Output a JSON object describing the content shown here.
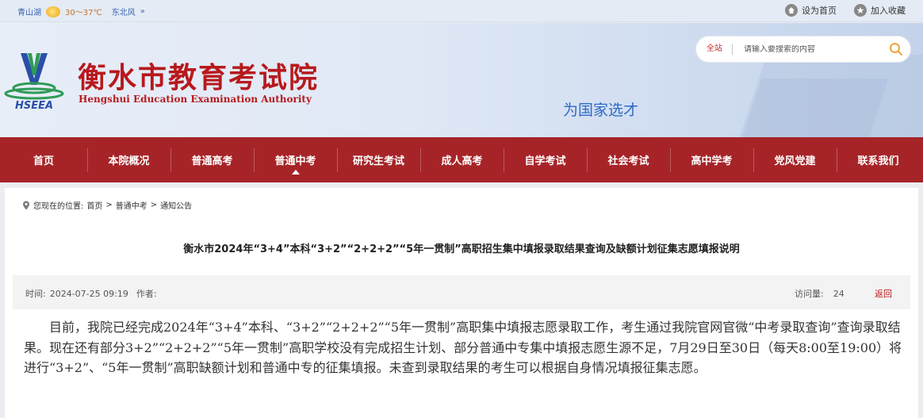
{
  "topbar": {
    "weather": {
      "city": "青山湖",
      "temp": "30～37℃",
      "wind": "东北风",
      "more": "»"
    },
    "links": [
      {
        "label": "设为首页",
        "icon": "home-icon"
      },
      {
        "label": "加入收藏",
        "icon": "star-icon"
      }
    ]
  },
  "header": {
    "logo_text": "HSEEA",
    "title_cn": "衡水市教育考试院",
    "title_en": "Hengshui Education Examination Authority",
    "slogan": "为国家选才",
    "search": {
      "scope": "全站",
      "placeholder": "请输入要搜索的内容",
      "icon": "search-icon"
    }
  },
  "nav": {
    "items": [
      {
        "label": "首页"
      },
      {
        "label": "本院概况"
      },
      {
        "label": "普通高考"
      },
      {
        "label": "普通中考",
        "active": true
      },
      {
        "label": "研究生考试"
      },
      {
        "label": "成人高考"
      },
      {
        "label": "自学考试"
      },
      {
        "label": "社会考试"
      },
      {
        "label": "高中学考"
      },
      {
        "label": "党风党建"
      },
      {
        "label": "联系我们"
      }
    ]
  },
  "breadcrumb": {
    "prefix": "您现在的位置:",
    "items": [
      "首页",
      "普通中考",
      "通知公告"
    ],
    "separator": ">"
  },
  "article": {
    "title": "衡水市2024年“3+4”本科“3+2”“2+2+2”“5年一贯制”高职招生集中填报录取结果查询及缺额计划征集志愿填报说明",
    "time_label": "时间:",
    "time": "2024-07-25 09:19",
    "author_label": "作者:",
    "author": "",
    "views_label": "访问量:",
    "views": "24",
    "back": "返回",
    "body": "目前，我院已经完成2024年“3+4”本科、“3+2”“2+2+2”“5年一贯制”高职集中填报志愿录取工作，考生通过我院官网官微“中考录取查询”查询录取结果。现在还有部分3+2”“2+2+2”“5年一贯制”高职学校没有完成招生计划、部分普通中专集中填报志愿生源不足，7月29日至30日（每天8:00至19:00）将进行“3+2”、“5年一贯制”高职缺额计划和普通中专的征集填报。未查到录取结果的考生可以根据自身情况填报征集志愿。"
  }
}
